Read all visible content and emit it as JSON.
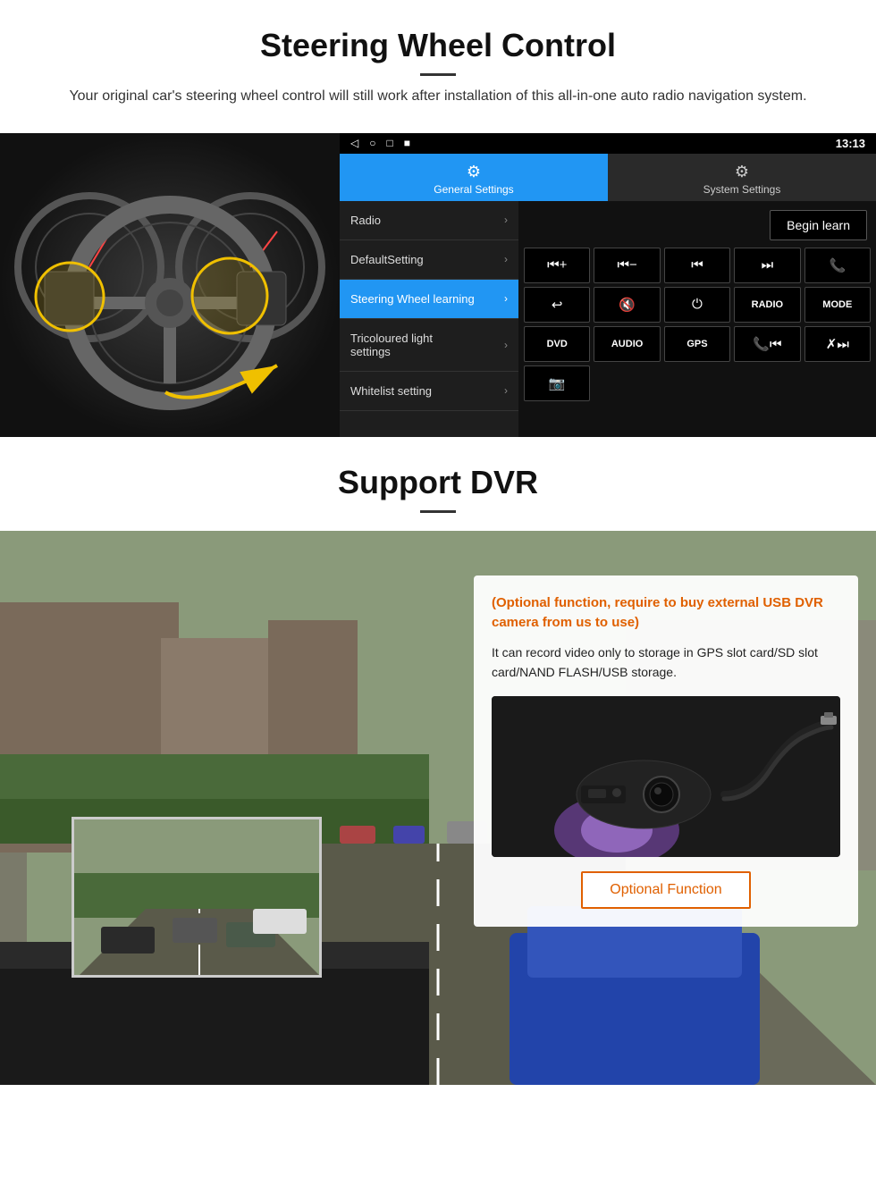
{
  "section1": {
    "title": "Steering Wheel Control",
    "subtitle": "Your original car's steering wheel control will still work after installation of this all-in-one auto radio navigation system.",
    "statusbar": {
      "icons": [
        "◁",
        "○",
        "□",
        "■"
      ],
      "time": "13:13",
      "signal": "▾"
    },
    "tabs": {
      "general": {
        "icon": "⚙",
        "label": "General Settings"
      },
      "system": {
        "icon": "⚡",
        "label": "System Settings"
      }
    },
    "menu": [
      {
        "label": "Radio",
        "active": false
      },
      {
        "label": "DefaultSetting",
        "active": false
      },
      {
        "label": "Steering Wheel learning",
        "active": true
      },
      {
        "label": "Tricoloured light settings",
        "active": false
      },
      {
        "label": "Whitelist setting",
        "active": false
      }
    ],
    "begin_learn": "Begin learn",
    "controls": [
      [
        "⏮+",
        "⏮-",
        "⏮",
        "⏭",
        "📞"
      ],
      [
        "↩",
        "🔇",
        "⏻",
        "RADIO",
        "MODE"
      ],
      [
        "DVD",
        "AUDIO",
        "GPS",
        "📞⏮",
        "✗⏭"
      ],
      [
        "📷"
      ]
    ]
  },
  "section2": {
    "title": "Support DVR",
    "optional_note": "(Optional function, require to buy external USB DVR camera from us to use)",
    "description": "It can record video only to storage in GPS slot card/SD slot card/NAND FLASH/USB storage.",
    "optional_btn": "Optional Function"
  }
}
